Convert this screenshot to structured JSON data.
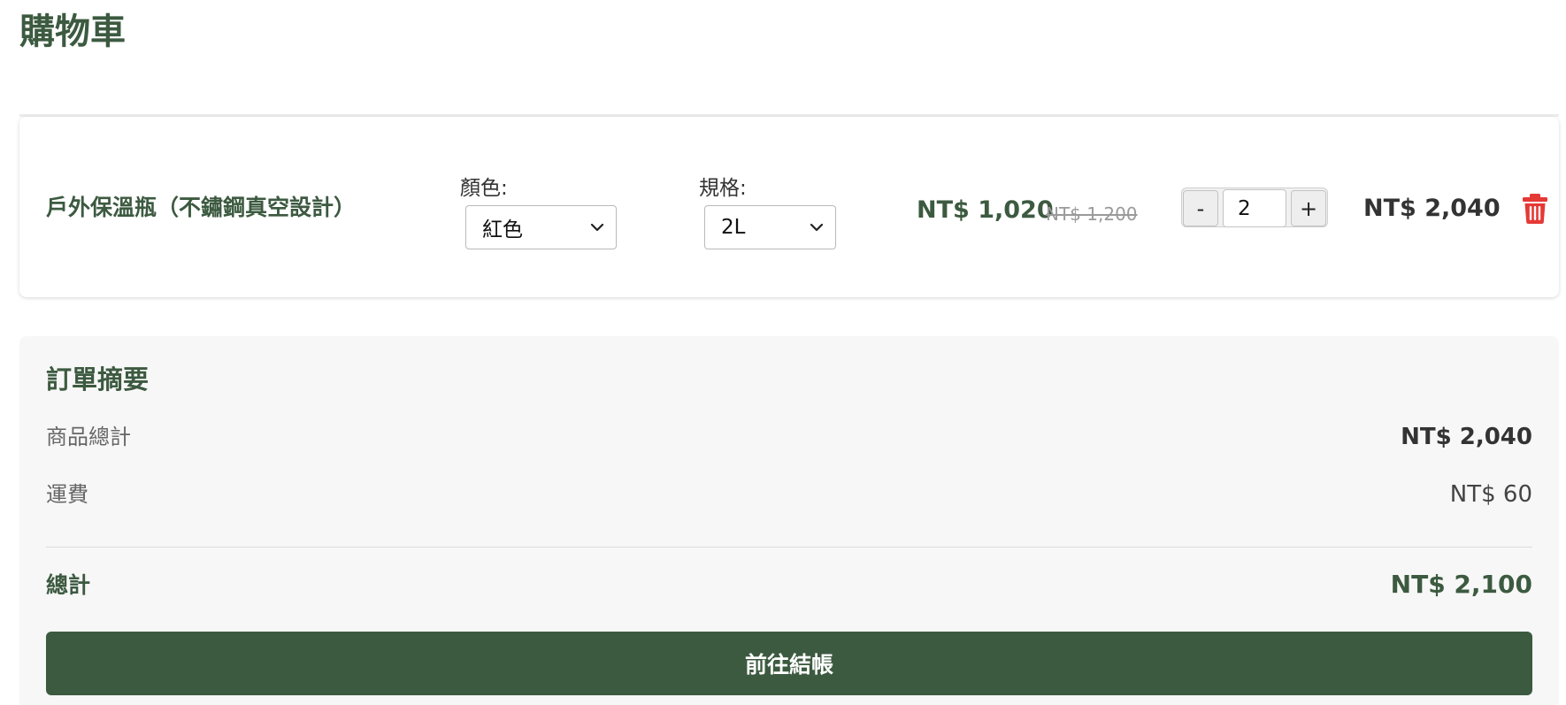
{
  "page": {
    "title": "購物車"
  },
  "cart": {
    "items": [
      {
        "name": "戶外保溫瓶（不鏽鋼真空設計）",
        "color_label": "顏色:",
        "color_selected": "紅色",
        "spec_label": "規格:",
        "spec_selected": "2L",
        "price": "NT$ 1,020",
        "original_price": "NT$ 1,200",
        "qty_minus_label": "-",
        "quantity": "2",
        "qty_plus_label": "+",
        "line_total": "NT$ 2,040"
      }
    ]
  },
  "summary": {
    "title": "訂單摘要",
    "subtotal_label": "商品總計",
    "subtotal_value": "NT$ 2,040",
    "shipping_label": "運費",
    "shipping_value": "NT$ 60",
    "total_label": "總計",
    "total_value": "NT$ 2,100",
    "checkout_label": "前往結帳"
  },
  "icons": {
    "delete": "trash-icon",
    "select_chevron": "chevron-down-icon"
  },
  "colors": {
    "brand_green": "#3c5a40",
    "delete_red": "#e53935",
    "summary_bg": "#f7f7f7",
    "strikethrough_gray": "#9a9a9a"
  }
}
